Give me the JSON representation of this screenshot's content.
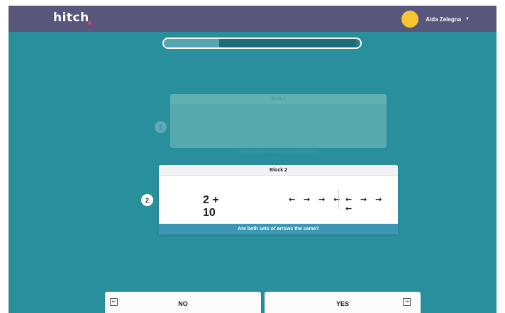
{
  "header": {
    "logo_text": "hitch",
    "user_name": "Aida Zelegna",
    "caret": "▼",
    "avatar_color": "#f9c432",
    "bar_color": "#58577b"
  },
  "progress": {
    "completed_fraction": 0.28,
    "current_fraction": 0.98
  },
  "block1": {
    "number": "1",
    "title": "Block 1",
    "question": "Is the answer to the sum an odd number?"
  },
  "block2": {
    "number": "2",
    "title": "Block 2",
    "math": "2 + 10",
    "arrows_left": "← → → ←",
    "arrows_right": "← → → ←",
    "question": "Are both sets of arrows the same?"
  },
  "answers": {
    "no_label": "NO",
    "yes_label": "YES",
    "no_key_icon": "left-arrow-key-icon",
    "yes_key_icon": "right-arrow-key-icon",
    "no_key_glyph": "←",
    "yes_key_glyph": "→"
  },
  "colors": {
    "background": "#2a8f9c",
    "question_bar": "#3b97b4"
  }
}
